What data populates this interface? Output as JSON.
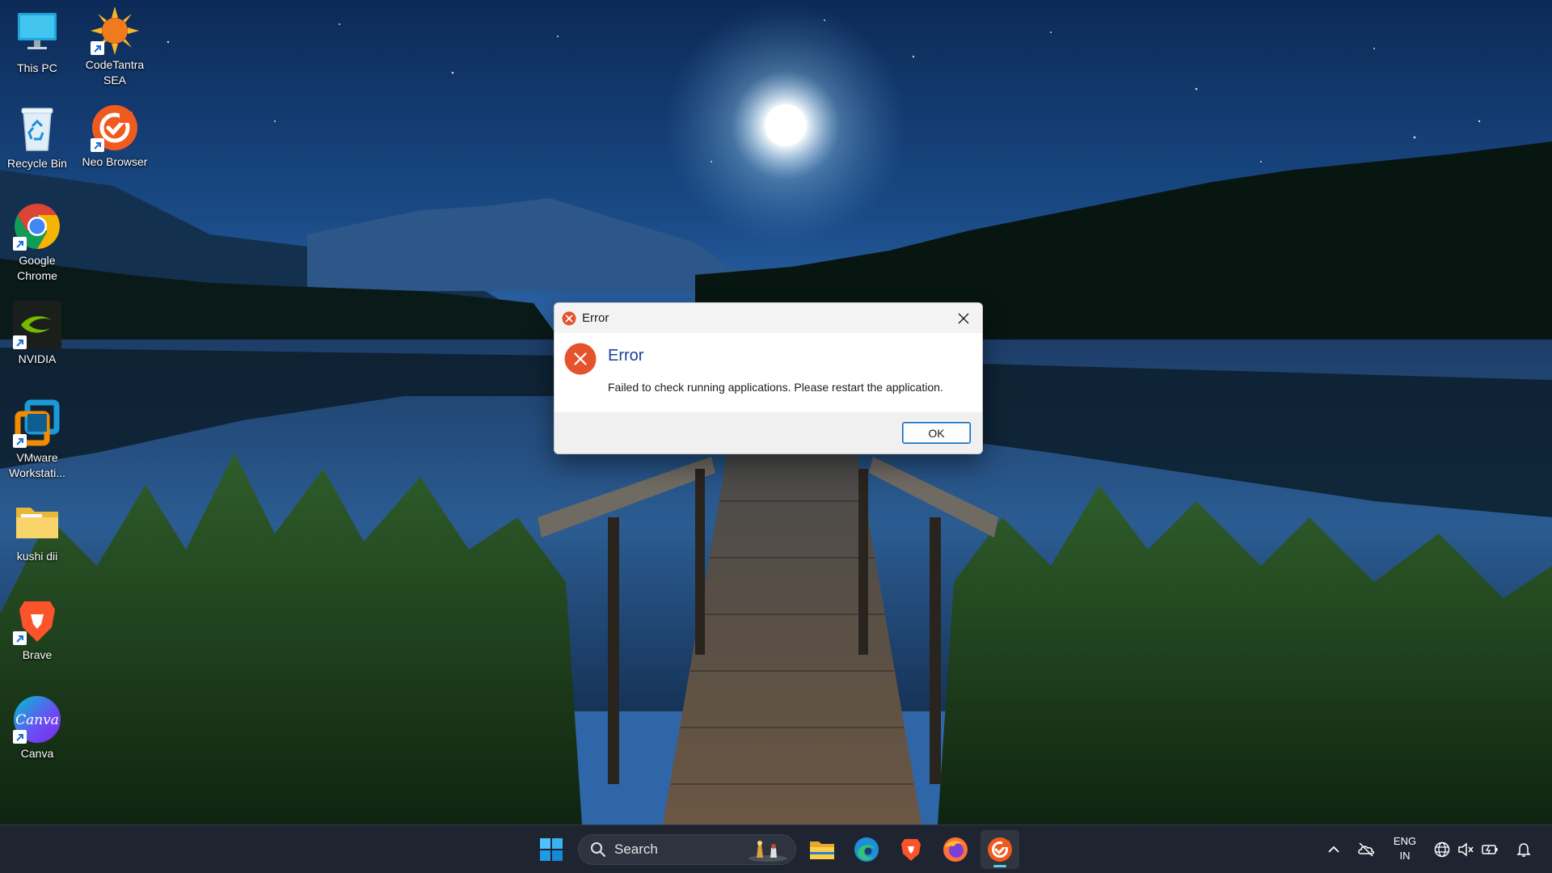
{
  "desktop": {
    "icons": [
      {
        "label": "This PC",
        "icon": "monitor-icon"
      },
      {
        "label": "CodeTantra SEA",
        "icon": "sun-icon",
        "shortcut": true
      },
      {
        "label": "Recycle Bin",
        "icon": "recycle-bin-icon"
      },
      {
        "label": "Neo Browser",
        "icon": "neo-browser-icon",
        "shortcut": true
      },
      {
        "label": "Google Chrome",
        "icon": "chrome-icon",
        "shortcut": true
      },
      {
        "label": "NVIDIA",
        "icon": "nvidia-icon",
        "shortcut": true
      },
      {
        "label": "VMware Workstati...",
        "icon": "vmware-icon",
        "shortcut": true
      },
      {
        "label": "kushi dii",
        "icon": "folder-icon"
      },
      {
        "label": "Brave",
        "icon": "brave-icon",
        "shortcut": true
      },
      {
        "label": "Canva",
        "icon": "canva-icon",
        "shortcut": true
      }
    ]
  },
  "dialog": {
    "title": "Error",
    "heading": "Error",
    "message": "Failed to check running applications. Please restart the application.",
    "ok_label": "OK",
    "icon": "error-icon",
    "accent": "#e5532d",
    "heading_color": "#1f3f99"
  },
  "taskbar": {
    "search_label": "Search",
    "apps": [
      "windows-start-icon",
      "file-explorer-icon",
      "edge-icon",
      "brave-icon",
      "firefox-icon",
      "neo-browser-icon"
    ],
    "active_app": "neo-browser-icon",
    "tray": {
      "lang_line1": "ENG",
      "lang_line2": "IN",
      "icons": [
        "chevron-up-icon",
        "onedrive-offline-icon",
        "network-icon",
        "volume-muted-icon",
        "battery-icon",
        "notification-icon"
      ]
    }
  },
  "canva_text": "Canva"
}
